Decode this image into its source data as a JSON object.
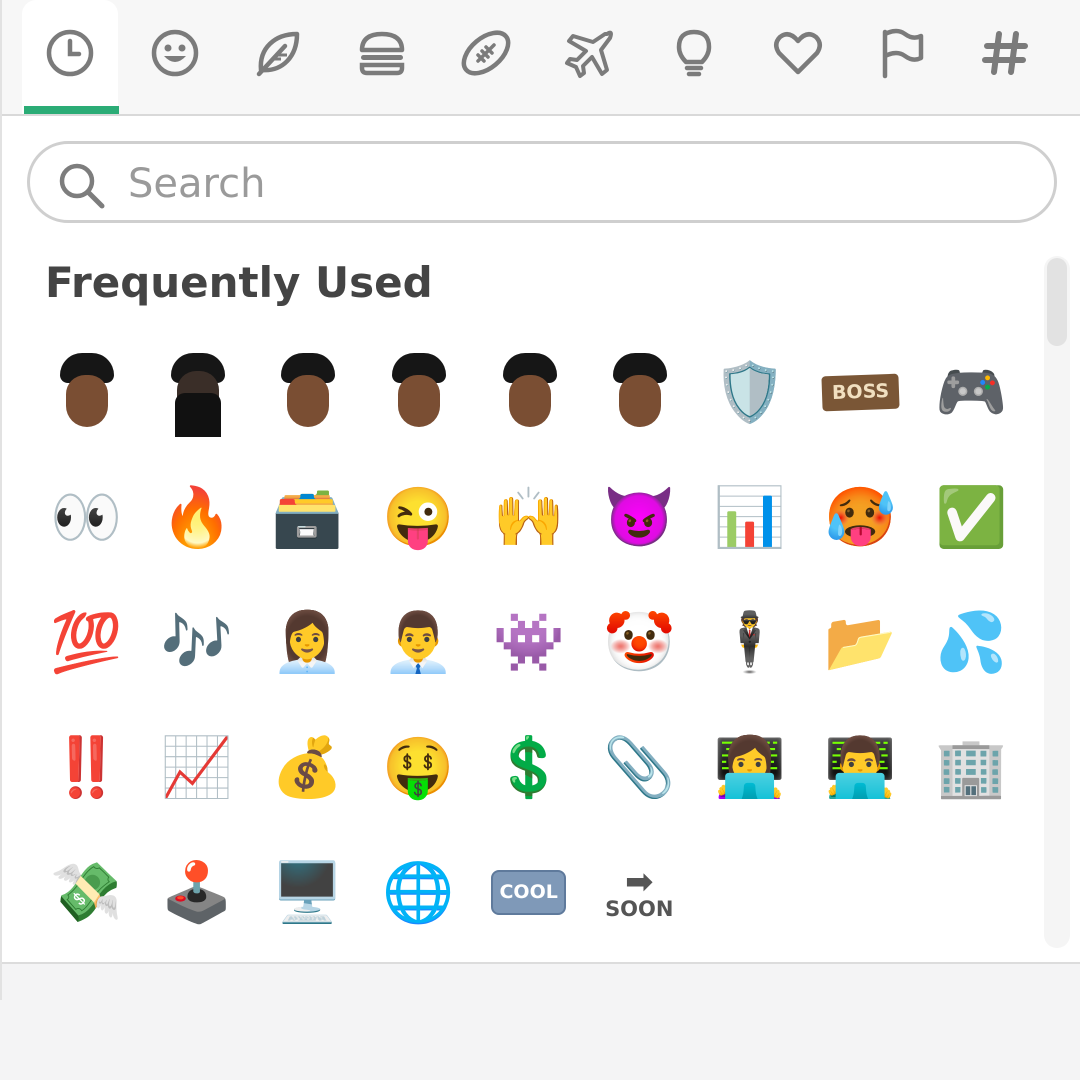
{
  "categories": [
    {
      "name": "recent",
      "glyph": "clock"
    },
    {
      "name": "smileys",
      "glyph": "smiley"
    },
    {
      "name": "nature",
      "glyph": "leaf"
    },
    {
      "name": "food",
      "glyph": "burger"
    },
    {
      "name": "activity",
      "glyph": "football"
    },
    {
      "name": "travel",
      "glyph": "airplane"
    },
    {
      "name": "objects",
      "glyph": "lightbulb"
    },
    {
      "name": "symbols",
      "glyph": "heart"
    },
    {
      "name": "flags",
      "glyph": "flag"
    },
    {
      "name": "custom",
      "glyph": "hashtag"
    }
  ],
  "accent_color": "#2bac76",
  "search": {
    "placeholder": "Search",
    "value": ""
  },
  "section": {
    "title": "Frequently Used"
  },
  "emojis": [
    {
      "type": "photo",
      "name": "lil-nas-x-leather-jacket"
    },
    {
      "type": "photo",
      "name": "lil-nas-x-standing"
    },
    {
      "type": "photo",
      "name": "lil-nas-x-thinking"
    },
    {
      "type": "photo",
      "name": "lil-nas-x-looking-up"
    },
    {
      "type": "photo",
      "name": "lil-nas-x-smiling"
    },
    {
      "type": "photo",
      "name": "lil-nas-x-grinning"
    },
    {
      "type": "char",
      "char": "🛡️",
      "name": "worlds-crest"
    },
    {
      "type": "text",
      "style": "boss",
      "text": "BOSS",
      "name": "boss-plaque"
    },
    {
      "type": "char",
      "char": "🎮",
      "name": "game-controller"
    },
    {
      "type": "char",
      "char": "👀",
      "name": "eyes"
    },
    {
      "type": "char",
      "char": "🔥",
      "name": "fire"
    },
    {
      "type": "char",
      "char": "🗃️",
      "name": "card-file-box"
    },
    {
      "type": "char",
      "char": "😜",
      "name": "winking-tongue"
    },
    {
      "type": "char",
      "char": "🙌",
      "name": "raised-hands"
    },
    {
      "type": "char",
      "char": "😈",
      "name": "smiling-imp"
    },
    {
      "type": "char",
      "char": "📊",
      "name": "bar-chart"
    },
    {
      "type": "char",
      "char": "🥵",
      "name": "hot-face"
    },
    {
      "type": "char",
      "char": "✅",
      "name": "check-mark"
    },
    {
      "type": "char",
      "char": "💯",
      "name": "hundred-points"
    },
    {
      "type": "char",
      "char": "🎶",
      "name": "musical-notes"
    },
    {
      "type": "char",
      "char": "👩‍💼",
      "name": "woman-office-worker"
    },
    {
      "type": "char",
      "char": "👨‍💼",
      "name": "man-office-worker"
    },
    {
      "type": "char",
      "char": "👾",
      "name": "alien-monster"
    },
    {
      "type": "char",
      "char": "🤡",
      "name": "clown-face"
    },
    {
      "type": "char",
      "char": "🕴️",
      "name": "levitating-man"
    },
    {
      "type": "char",
      "char": "📂",
      "name": "open-folder"
    },
    {
      "type": "char",
      "char": "💦",
      "name": "sweat-droplets"
    },
    {
      "type": "char",
      "char": "‼️",
      "name": "double-exclamation"
    },
    {
      "type": "char",
      "char": "📈",
      "name": "chart-increasing"
    },
    {
      "type": "char",
      "char": "💰",
      "name": "money-bag"
    },
    {
      "type": "char",
      "char": "🤑",
      "name": "money-mouth-face"
    },
    {
      "type": "char",
      "char": "💲",
      "name": "dollar-sign"
    },
    {
      "type": "char",
      "char": "📎",
      "name": "paperclip"
    },
    {
      "type": "char",
      "char": "👩‍💻",
      "name": "woman-technologist"
    },
    {
      "type": "char",
      "char": "👨‍💻",
      "name": "man-technologist"
    },
    {
      "type": "char",
      "char": "🏢",
      "name": "office-building"
    },
    {
      "type": "char",
      "char": "💸",
      "name": "money-with-wings"
    },
    {
      "type": "char",
      "char": "🕹️",
      "name": "joystick"
    },
    {
      "type": "char",
      "char": "🖥️",
      "name": "desktop-computer"
    },
    {
      "type": "char",
      "char": "🌐",
      "name": "globe-with-meridians"
    },
    {
      "type": "text",
      "style": "cool",
      "text": "COOL",
      "name": "cool-button"
    },
    {
      "type": "text",
      "style": "soon",
      "text": "SOON",
      "name": "soon-arrow"
    }
  ]
}
